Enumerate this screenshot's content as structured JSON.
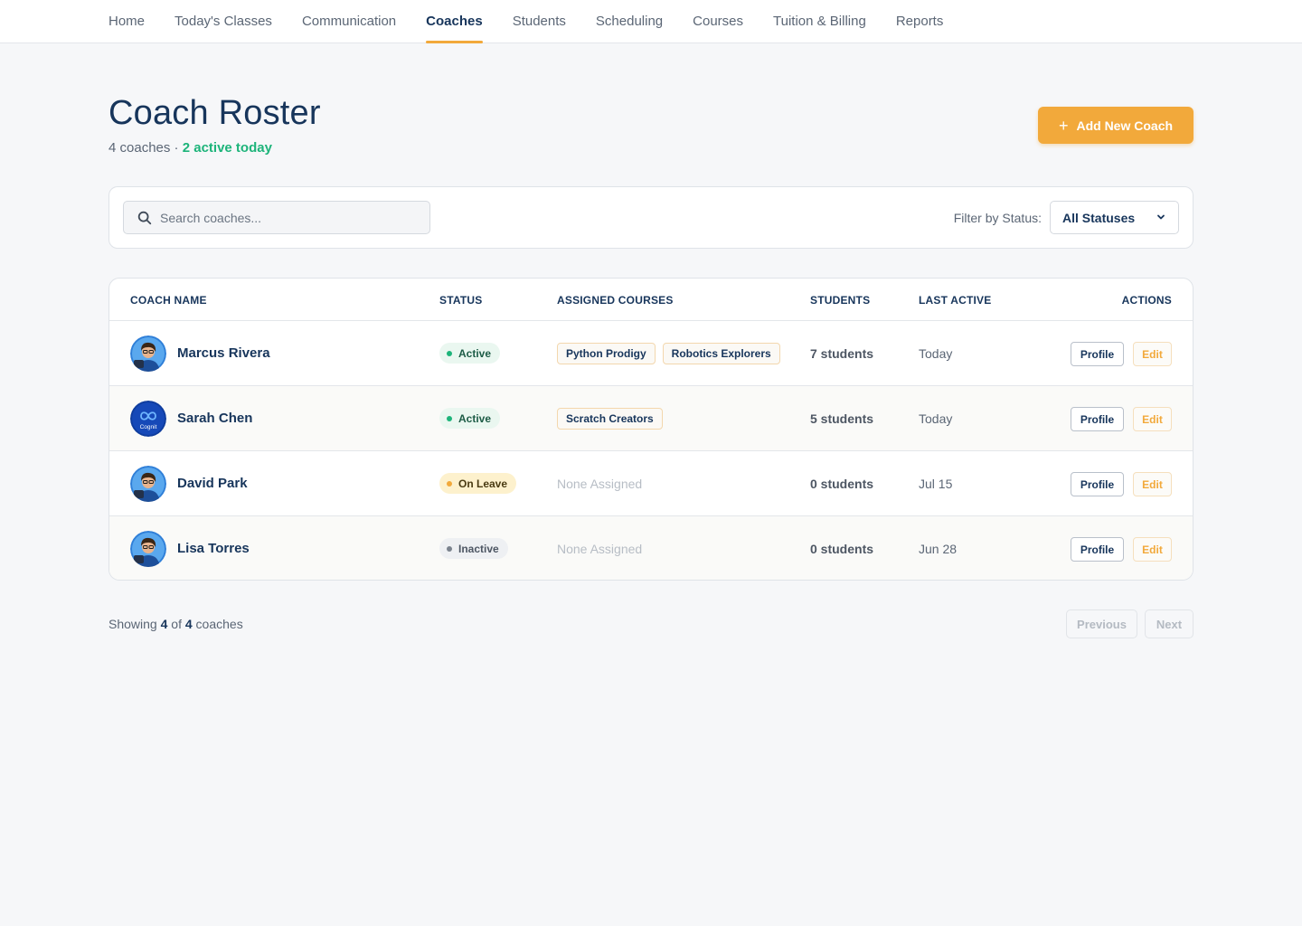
{
  "nav": {
    "items": [
      {
        "label": "Home",
        "active": false
      },
      {
        "label": "Today's Classes",
        "active": false
      },
      {
        "label": "Communication",
        "active": false
      },
      {
        "label": "Coaches",
        "active": true
      },
      {
        "label": "Students",
        "active": false
      },
      {
        "label": "Scheduling",
        "active": false
      },
      {
        "label": "Courses",
        "active": false
      },
      {
        "label": "Tuition & Billing",
        "active": false
      },
      {
        "label": "Reports",
        "active": false
      }
    ]
  },
  "header": {
    "title": "Coach Roster",
    "count_text": "4 coaches · ",
    "active_today": "2 active today",
    "add_button": "Add New Coach",
    "add_icon": "+"
  },
  "filters": {
    "search_placeholder": "Search coaches...",
    "status_label": "Filter by Status:",
    "status_value": "All Statuses"
  },
  "table": {
    "headers": [
      "COACH NAME",
      "STATUS",
      "ASSIGNED COURSES",
      "STUDENTS",
      "LAST ACTIVE",
      "ACTIONS"
    ],
    "rows": [
      {
        "name": "Marcus Rivera",
        "avatar": "coach-illustration",
        "status": "Active",
        "status_kind": "active",
        "courses": [
          "Python Prodigy",
          "Robotics Explorers"
        ],
        "none_text": "",
        "students": "7 students",
        "last_active": "Today",
        "profile": "Profile",
        "edit": "Edit"
      },
      {
        "name": "Sarah Chen",
        "avatar": "cognit-logo",
        "avatar_text": "Cognit",
        "status": "Active",
        "status_kind": "active",
        "courses": [
          "Scratch Creators"
        ],
        "none_text": "",
        "students": "5 students",
        "last_active": "Today",
        "profile": "Profile",
        "edit": "Edit"
      },
      {
        "name": "David Park",
        "avatar": "coach-illustration",
        "status": "On Leave",
        "status_kind": "leave",
        "courses": [],
        "none_text": "None Assigned",
        "students": "0 students",
        "last_active": "Jul 15",
        "profile": "Profile",
        "edit": "Edit"
      },
      {
        "name": "Lisa Torres",
        "avatar": "coach-illustration",
        "status": "Inactive",
        "status_kind": "inactive",
        "courses": [],
        "none_text": "None Assigned",
        "students": "0 students",
        "last_active": "Jun 28",
        "profile": "Profile",
        "edit": "Edit"
      }
    ]
  },
  "footer": {
    "showing_prefix": "Showing ",
    "shown": "4",
    "of": " of ",
    "total": "4",
    "suffix": " coaches",
    "prev": "Previous",
    "next": "Next"
  },
  "colors": {
    "accent": "#f2a93b",
    "active_green": "#1db47a",
    "navy": "#17355b"
  }
}
